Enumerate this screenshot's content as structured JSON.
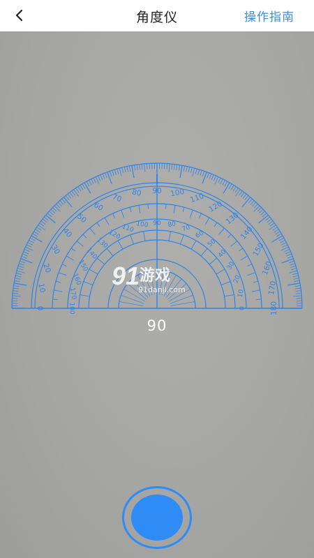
{
  "header": {
    "title": "角度仪",
    "guide_label": "操作指南",
    "back_icon": "chevron-left-icon"
  },
  "protractor": {
    "outer_scale": [
      "0",
      "10",
      "20",
      "30",
      "40",
      "50",
      "60",
      "70",
      "80",
      "90",
      "100",
      "110",
      "120",
      "130",
      "140",
      "150",
      "160",
      "170",
      "180"
    ],
    "inner_scale": [
      "180",
      "170",
      "160",
      "150",
      "140",
      "130",
      "120",
      "110",
      "100",
      "90",
      "80",
      "70",
      "60",
      "50",
      "40",
      "30",
      "20",
      "10",
      "0"
    ],
    "angle_reading": "90",
    "color": "#2f84e6"
  },
  "watermark": {
    "logo_number": "91",
    "logo_text": "游戏",
    "site": "91danji.com"
  },
  "controls": {
    "shutter_icon": "capture-button-icon",
    "accent": "#2f8bf5"
  }
}
